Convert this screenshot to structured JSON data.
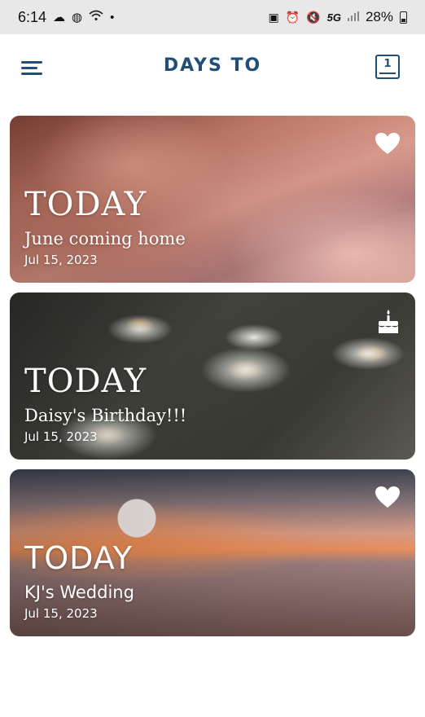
{
  "status_bar": {
    "time": "6:14",
    "network": "5G",
    "battery": "28%",
    "icons": [
      "weather-icon",
      "app-icon",
      "wifi-icon",
      "dot-icon",
      "vibrate-icon",
      "alarm-icon",
      "mute-icon",
      "signal-icon",
      "battery-icon"
    ]
  },
  "app_bar": {
    "title": "DAYS TO",
    "calendar_day": "1"
  },
  "events": [
    {
      "count_label": "TODAY",
      "name": "June coming home",
      "date": "Jul 15, 2023",
      "icon": "heart-icon"
    },
    {
      "count_label": "TODAY",
      "name": "Daisy's Birthday!!!",
      "date": "Jul 15, 2023",
      "icon": "birthday-cake-icon"
    },
    {
      "count_label": "TODAY",
      "name": "KJ's Wedding",
      "date": "Jul 15, 2023",
      "icon": "heart-icon"
    }
  ],
  "colors": {
    "primary": "#1f4e79",
    "card_text": "#ffffff",
    "status_bar_bg": "#e8e8e8"
  }
}
